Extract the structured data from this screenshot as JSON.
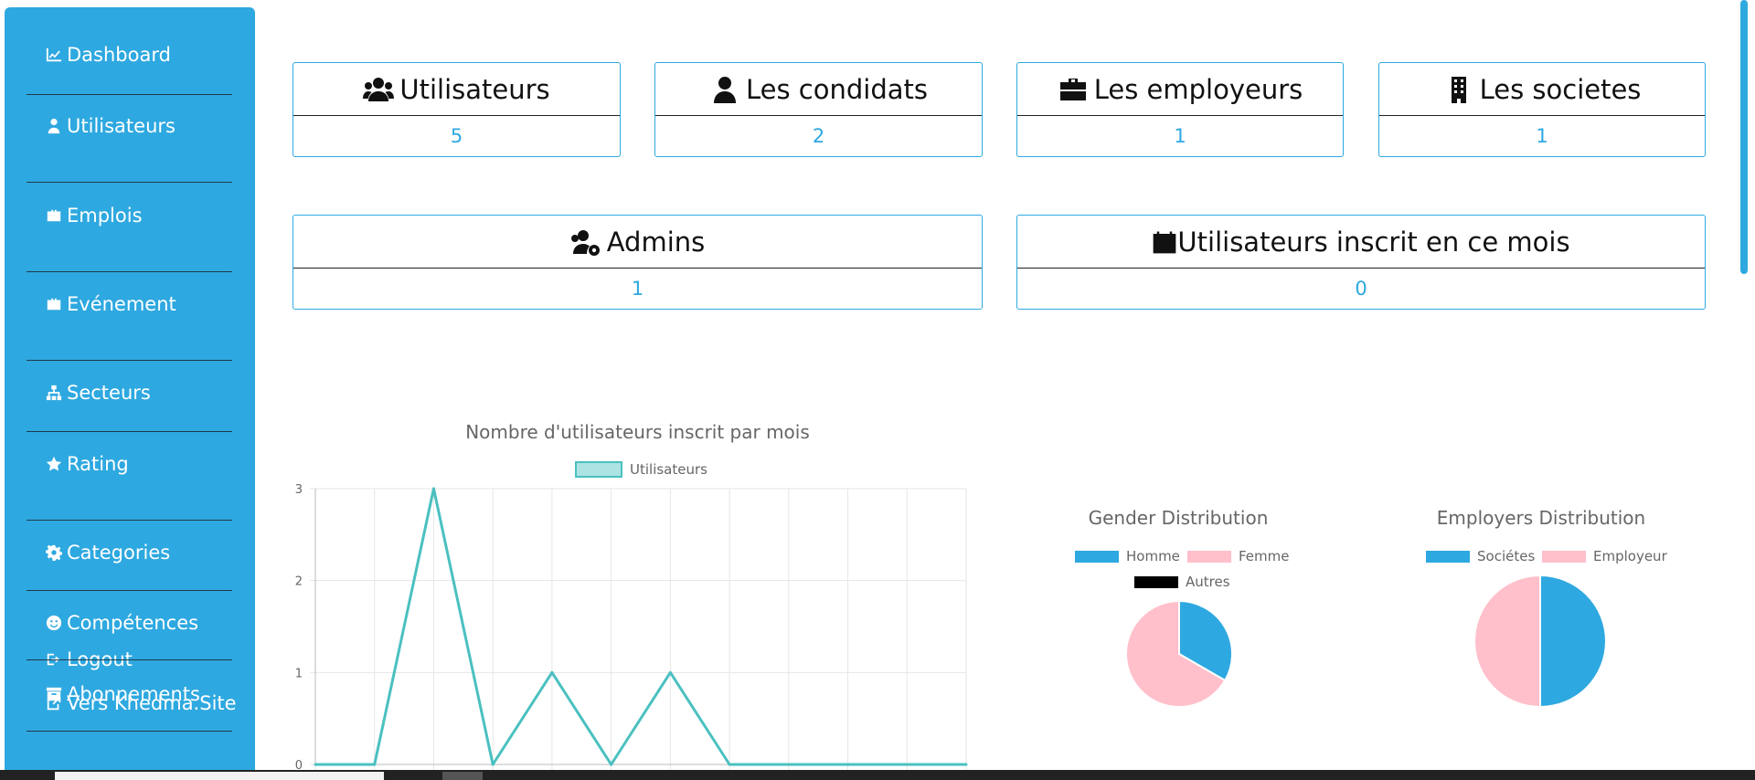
{
  "sidebar": {
    "items": [
      {
        "label": "Dashboard",
        "icon": "chart-line-icon"
      },
      {
        "label": "Utilisateurs",
        "icon": "user-tie-icon"
      },
      {
        "label": "Emplois",
        "icon": "briefcase-icon"
      },
      {
        "label": "Evénement",
        "icon": "briefcase-icon"
      },
      {
        "label": "Secteurs",
        "icon": "sitemap-icon"
      },
      {
        "label": "Rating",
        "icon": "star-icon"
      },
      {
        "label": "Categories",
        "icon": "cog-icon"
      },
      {
        "label": "Compétences",
        "icon": "smile-icon"
      },
      {
        "label": "Logout",
        "icon": "sign-out-icon"
      },
      {
        "label": "Abonnements",
        "icon": "archive-icon"
      },
      {
        "label": "Vers Khedma.Site",
        "icon": "external-link-icon"
      }
    ]
  },
  "stats": {
    "utilisateurs": {
      "label": "Utilisateurs",
      "value": "5"
    },
    "condidats": {
      "label": "Les condidats",
      "value": "2"
    },
    "employeurs": {
      "label": "Les employeurs",
      "value": "1"
    },
    "societes": {
      "label": "Les societes",
      "value": "1"
    },
    "admins": {
      "label": "Admins",
      "value": "1"
    },
    "inscrits": {
      "label": "Utilisateurs inscrit en ce mois",
      "value": "0"
    }
  },
  "colors": {
    "accent": "#2ea8e0",
    "line": "#4bc0c0",
    "pink": "#ffc0cb",
    "black": "#000000"
  },
  "chart_data": [
    {
      "type": "line",
      "title": "Nombre d'utilisateurs inscrit par mois",
      "legend": "top",
      "grid": true,
      "ylim": [
        0,
        3
      ],
      "yticks": [
        "3",
        "2",
        "1",
        "0"
      ],
      "series": [
        {
          "name": "Utilisateurs",
          "values": [
            0,
            0,
            3,
            0,
            1,
            0,
            1,
            0,
            0,
            0,
            0,
            0
          ],
          "color": "#4bc0c0"
        }
      ]
    },
    {
      "type": "pie",
      "title": "Gender Distribution",
      "legend": "top",
      "labels": [
        "Homme",
        "Femme",
        "Autres"
      ],
      "values": [
        1,
        2,
        0
      ],
      "colors": [
        "#2ea8e0",
        "#ffc0cb",
        "#000000"
      ]
    },
    {
      "type": "pie",
      "title": "Employers Distribution",
      "legend": "top",
      "labels": [
        "Sociétes",
        "Employeur"
      ],
      "values": [
        1,
        1
      ],
      "colors": [
        "#2ea8e0",
        "#ffc0cb"
      ]
    }
  ]
}
